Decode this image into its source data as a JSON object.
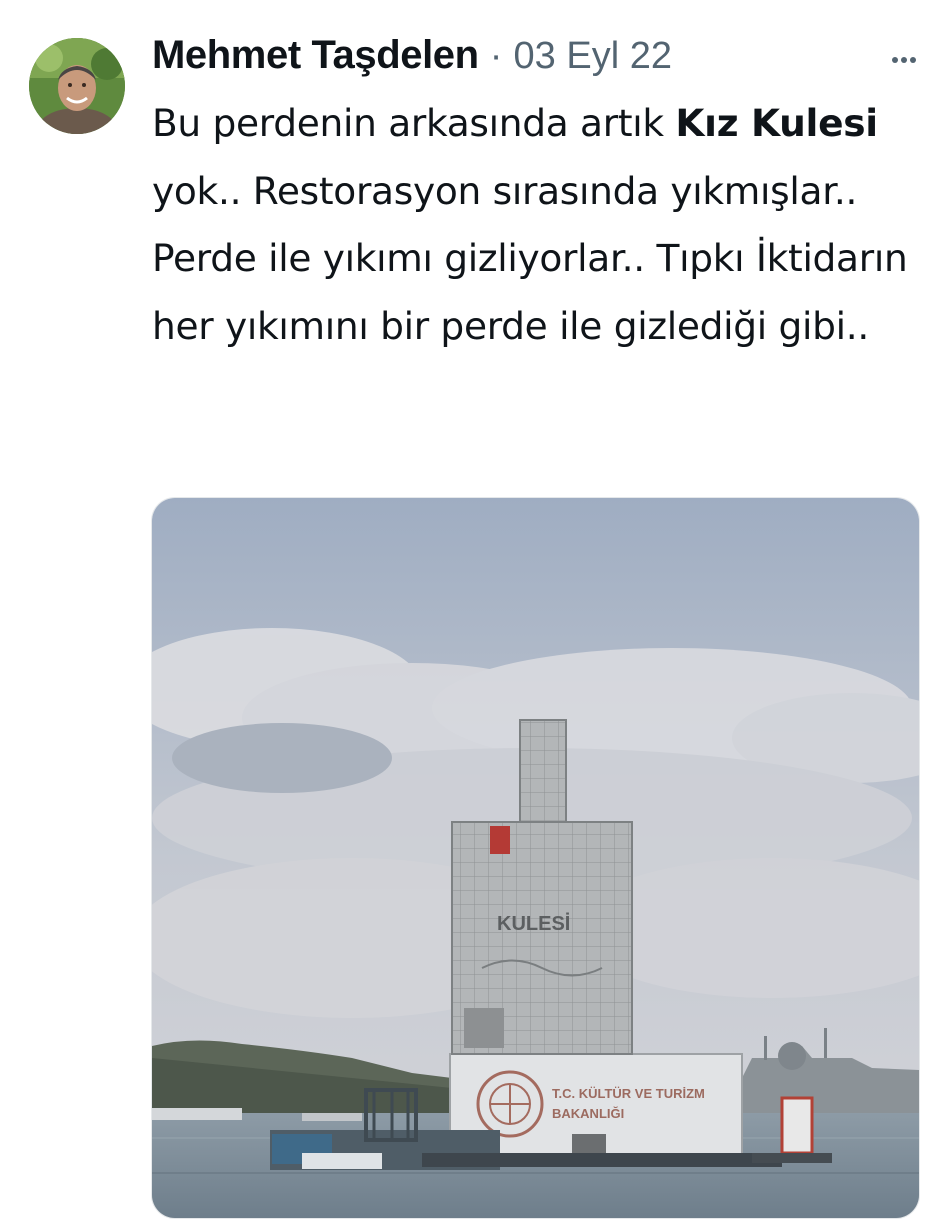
{
  "tweet": {
    "author_name": "Mehmet Taşdelen",
    "separator": "·",
    "date": "03 Eyl 22",
    "text_parts": [
      {
        "text": "Bu perdenin arkasında artık ",
        "bold": false
      },
      {
        "text": "Kız Kulesi",
        "bold": true
      },
      {
        "text": " yok.. Restorasyon sırasında yıkmışlar.. Perde ile yıkımı gizliyorlar.. Tıpkı İktidarın her yıkımını bir perde ile gizlediği gibi..",
        "bold": false
      }
    ]
  },
  "media": {
    "scaffold_banner_text": "KULESİ",
    "sign_line1": "T.C. KÜLTÜR VE TURİZM",
    "sign_line2": "BAKANLIĞI"
  },
  "icons": {
    "more": "more-horizontal-icon",
    "avatar": "avatar-photo"
  },
  "colors": {
    "text_primary": "#0f1419",
    "text_secondary": "#536471",
    "sky_top": "#9eabbf",
    "sky_bottom": "#cdd1d8",
    "water": "#7e8e9b"
  }
}
